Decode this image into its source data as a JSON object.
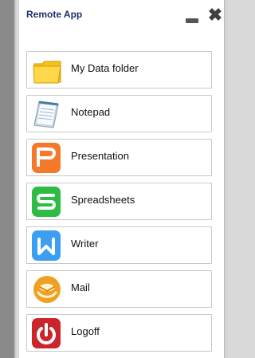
{
  "app": {
    "title": "Remote App"
  },
  "menu": {
    "items": [
      {
        "label": "My Data folder"
      },
      {
        "label": "Notepad"
      },
      {
        "label": "Presentation"
      },
      {
        "label": "Spreadsheets"
      },
      {
        "label": "Writer"
      },
      {
        "label": "Mail"
      },
      {
        "label": "Logoff"
      }
    ]
  },
  "icons": {
    "folder": "folder-icon",
    "notepad": "notepad-icon",
    "presentation": "presentation-icon",
    "spreadsheets": "spreadsheets-icon",
    "writer": "writer-icon",
    "mail": "mail-icon",
    "logoff": "power-icon"
  },
  "colors": {
    "title": "#1f2f6b",
    "presentation": "#f27a2a",
    "spreadsheets": "#2ebc45",
    "writer": "#3b9ef1",
    "mail": "#f0a020",
    "logoff": "#c9252a"
  }
}
